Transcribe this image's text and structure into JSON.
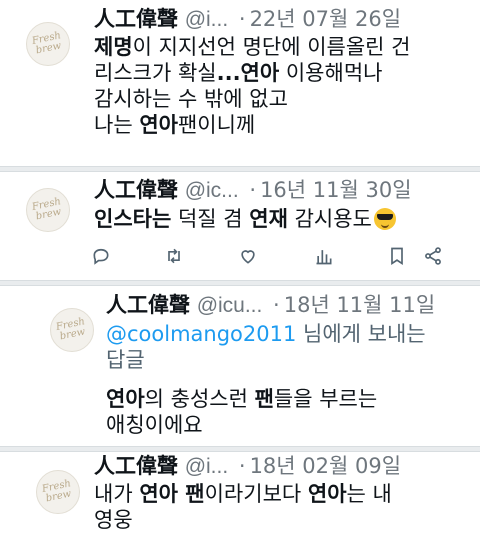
{
  "tweets": [
    {
      "name": "人工偉聲",
      "handle": "@i...",
      "date": "22년 07월 26일",
      "avatar_text": "Fresh\nbrew",
      "lines": [
        [
          {
            "t": "제명",
            "b": true
          },
          {
            "t": "이 지지선언 명단에 이름올린 건"
          }
        ],
        [
          {
            "t": "리스크가 확실"
          },
          {
            "t": "...연아",
            "b": true
          },
          {
            "t": " 이용해먹나"
          }
        ],
        [
          {
            "t": "감시하는 수 밖에 없고"
          }
        ],
        [
          {
            "t": "나는 "
          },
          {
            "t": "연아",
            "b": true
          },
          {
            "t": "팬이니께"
          }
        ]
      ]
    },
    {
      "name": "人工偉聲",
      "handle": "@ic...",
      "date": "16년 11월 30일",
      "avatar_text": "Fresh\nbrew",
      "lines": [
        [
          {
            "t": "인스타는",
            "b": true
          },
          {
            "t": " 덕질 겸 "
          },
          {
            "t": "연재",
            "b": true
          },
          {
            "t": " 감시용도"
          }
        ]
      ],
      "emoji": "smiling-face-with-sunglasses"
    },
    {
      "name": "人工偉聲",
      "handle": "@icu...",
      "date": "18년 11월 11일",
      "avatar_text": "Fresh\nbrew",
      "reply_to_mention": "@coolmango2011",
      "reply_to_rest": " 님에게 보내는",
      "reply_to_line2": "답글",
      "lines": [
        [
          {
            "t": "연아",
            "b": true
          },
          {
            "t": "의 충성스런 "
          },
          {
            "t": "팬",
            "b": true
          },
          {
            "t": "들을 부르는"
          }
        ],
        [
          {
            "t": "애칭이에요"
          }
        ]
      ]
    },
    {
      "name": "人工偉聲",
      "handle": "@i...",
      "date": "18년 02월 09일",
      "avatar_text": "Fresh\nbrew",
      "lines": [
        [
          {
            "t": "내가 "
          },
          {
            "t": "연아 팬",
            "b": true
          },
          {
            "t": "이라기보다 "
          },
          {
            "t": "연아",
            "b": true
          },
          {
            "t": "는 내"
          }
        ],
        [
          {
            "t": "영웅"
          }
        ]
      ]
    }
  ],
  "separator_char": "·",
  "action_icons": [
    "reply-icon",
    "retweet-icon",
    "like-icon",
    "views-icon",
    "bookmark-icon",
    "share-icon"
  ]
}
